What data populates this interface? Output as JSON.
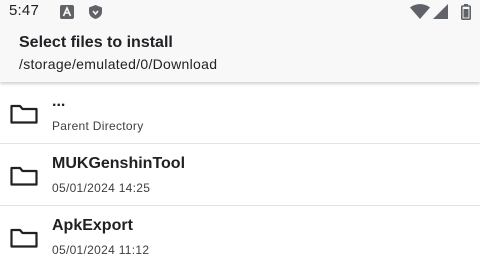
{
  "status_bar": {
    "time": "5:47",
    "left_icons": [
      "notification-a-icon",
      "shield-icon"
    ],
    "right_icons": [
      "wifi-icon",
      "signal-icon",
      "battery-icon"
    ]
  },
  "header": {
    "title": "Select files to install",
    "path": "/storage/emulated/0/Download"
  },
  "rows": [
    {
      "name": "...",
      "subtitle": "Parent Directory",
      "icon": "folder-icon"
    },
    {
      "name": "MUKGenshinTool",
      "subtitle": "05/01/2024 14:25",
      "icon": "folder-icon"
    },
    {
      "name": "ApkExport",
      "subtitle": "05/01/2024 11:12",
      "icon": "folder-icon"
    }
  ]
}
